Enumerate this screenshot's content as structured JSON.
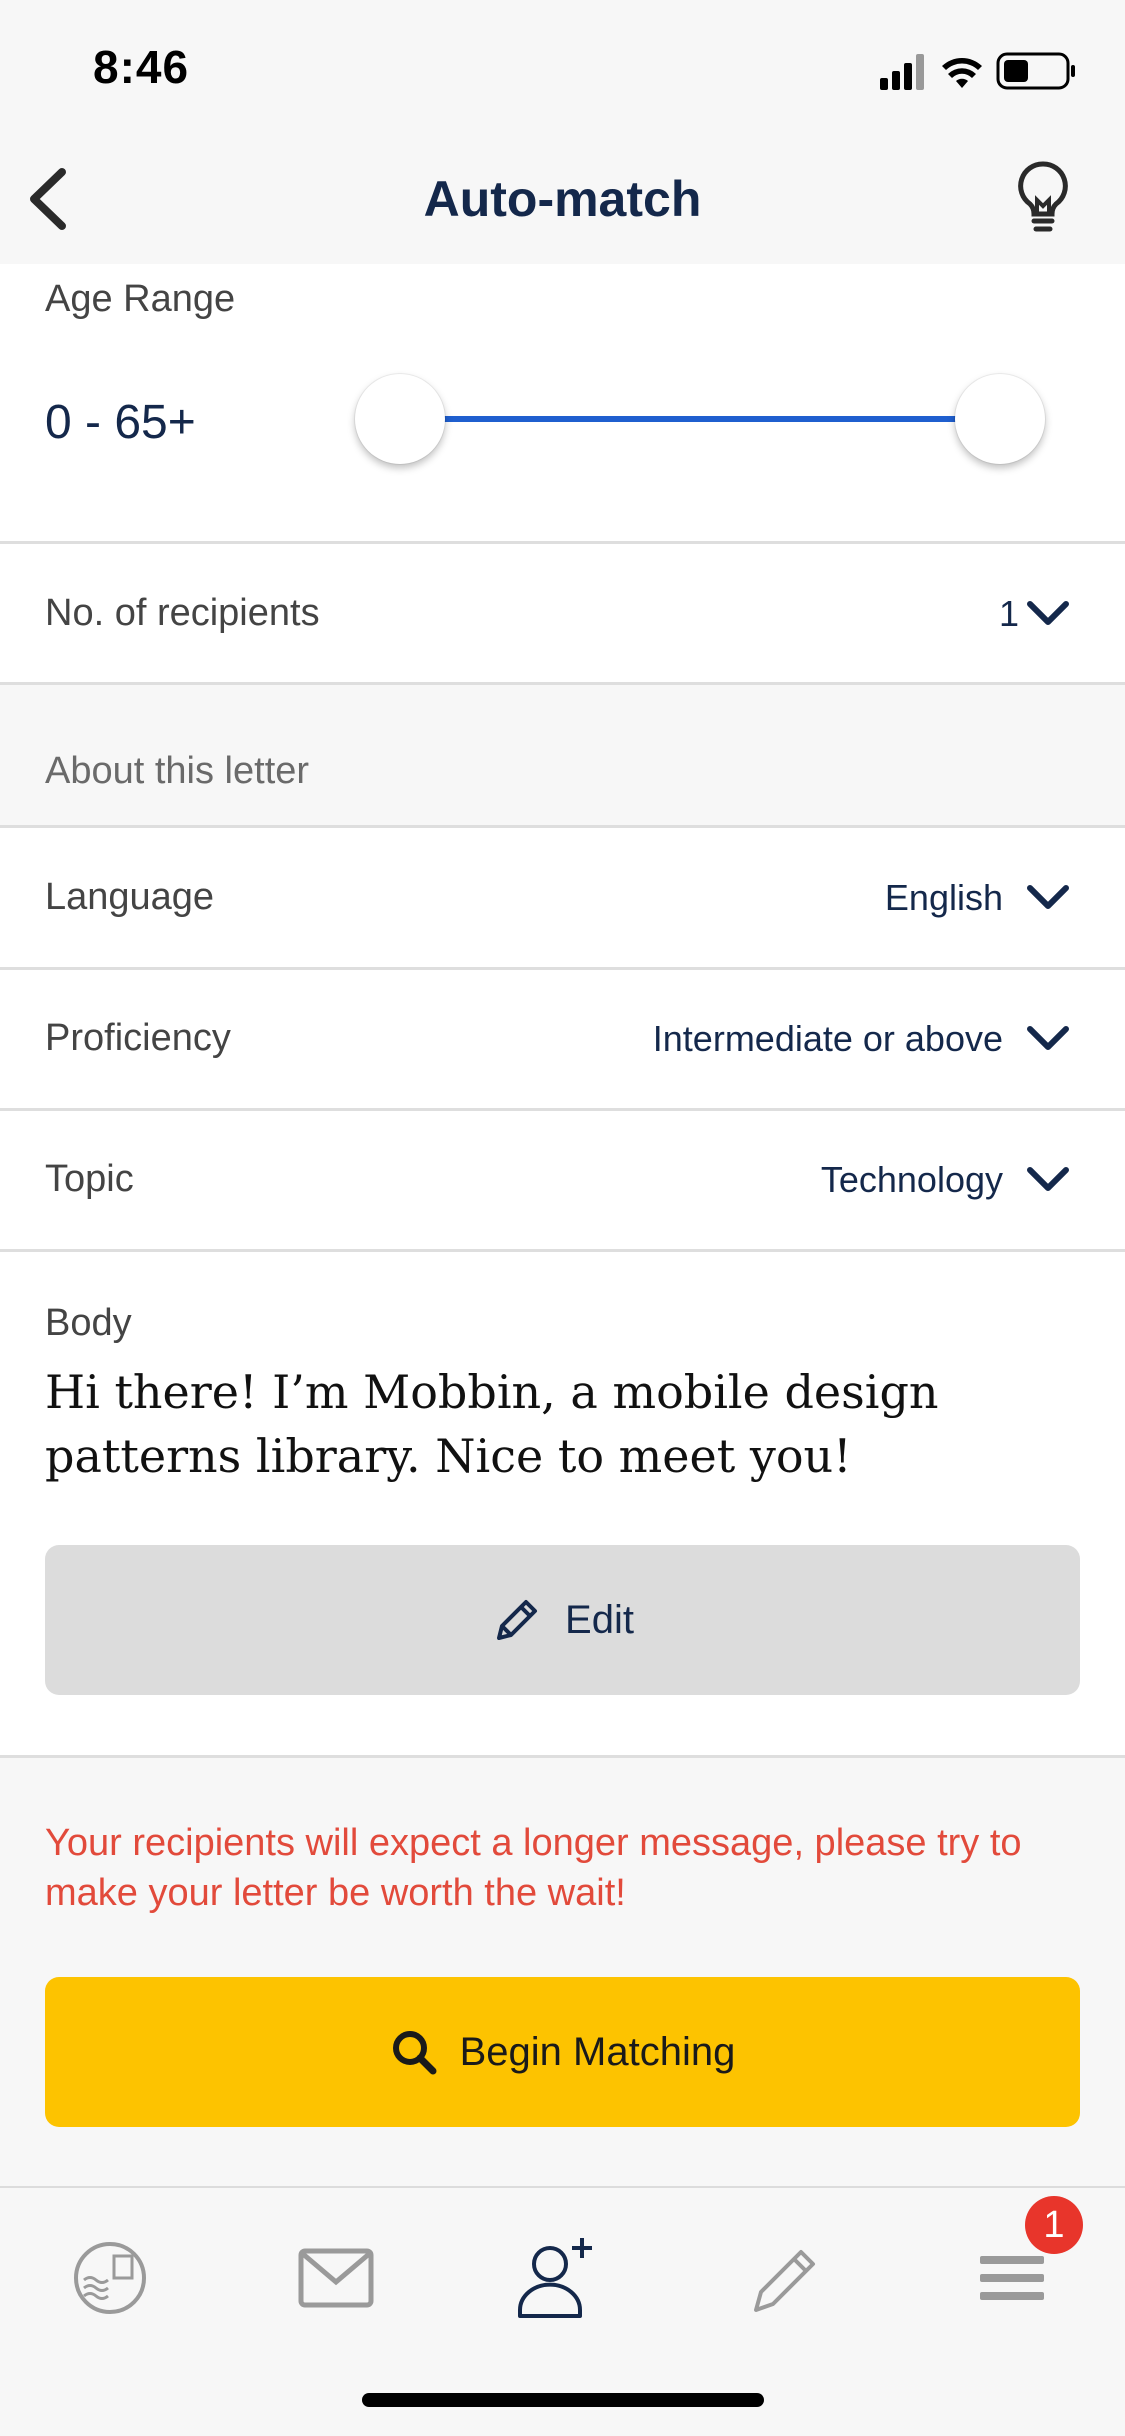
{
  "status_bar": {
    "time": "8:46"
  },
  "nav": {
    "title": "Auto-match"
  },
  "age_range": {
    "label": "Age Range",
    "value": "0 - 65+",
    "min_fraction": 0.0,
    "max_fraction": 1.0
  },
  "recipients": {
    "label": "No. of recipients",
    "value": "1"
  },
  "about_section": {
    "label": "About this letter"
  },
  "language": {
    "label": "Language",
    "value": "English"
  },
  "proficiency": {
    "label": "Proficiency",
    "value": "Intermediate or above"
  },
  "topic": {
    "label": "Topic",
    "value": "Technology"
  },
  "body": {
    "label": "Body",
    "text": "Hi there! I’m Mobbin, a mobile design patterns library. Nice to meet you!"
  },
  "edit_button": {
    "label": "Edit"
  },
  "warning": {
    "text": "Your recipients will expect a longer message, please try to make your letter be worth the wait!"
  },
  "begin_button": {
    "label": "Begin Matching"
  },
  "tab_bar": {
    "items": [
      {
        "icon": "stamp-icon"
      },
      {
        "icon": "mail-icon"
      },
      {
        "icon": "add-user-icon",
        "active": true
      },
      {
        "icon": "pencil-icon"
      },
      {
        "icon": "menu-icon",
        "badge": "1"
      }
    ]
  },
  "colors": {
    "accent_blue": "#1f5fcf",
    "primary_yellow": "#fdc300",
    "warning_red": "#e24a3b",
    "nav_text": "#14284b"
  }
}
